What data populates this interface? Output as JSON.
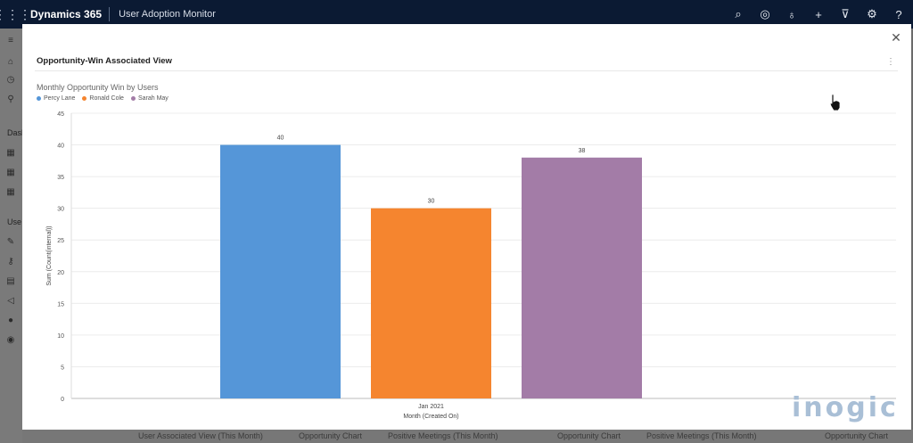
{
  "topbar": {
    "brand": "Dynamics 365",
    "app_name": "User Adoption Monitor",
    "icons": [
      "search-icon",
      "target-icon",
      "lightbulb-icon",
      "plus-icon",
      "filter-icon",
      "gear-icon",
      "help-icon"
    ]
  },
  "leftnav": {
    "section_labels": [
      "Dash",
      "Use"
    ]
  },
  "dialog": {
    "title": "Opportunity-Win Associated View"
  },
  "background": {
    "strip_texts": [
      "User Associated View (This Month)",
      "Opportunity Chart",
      "Positive Meetings (This Month)",
      "Opportunity Chart",
      "Positive Meetings (This Month)",
      "Opportunity Chart"
    ]
  },
  "logo": {
    "text": "inogic"
  },
  "colors": {
    "topbar": "#0b1a33",
    "percy": "#5596d8",
    "ronald": "#f5852f",
    "sarah": "#a37ca7"
  },
  "chart_data": {
    "type": "bar",
    "title": "Monthly Opportunity Win by Users",
    "xlabel": "Month (Created On)",
    "ylabel": "Sum (Count(internal))",
    "categories": [
      "Jan 2021"
    ],
    "series": [
      {
        "name": "Percy Lane",
        "values": [
          40
        ],
        "color": "#5596d8"
      },
      {
        "name": "Ronald Cole",
        "values": [
          30
        ],
        "color": "#f5852f"
      },
      {
        "name": "Sarah May",
        "values": [
          38
        ],
        "color": "#a37ca7"
      }
    ],
    "ylim": [
      0,
      45
    ],
    "yticks": [
      0,
      5,
      10,
      15,
      20,
      25,
      30,
      35,
      40,
      45
    ],
    "grid": true,
    "legend": "top-left"
  }
}
